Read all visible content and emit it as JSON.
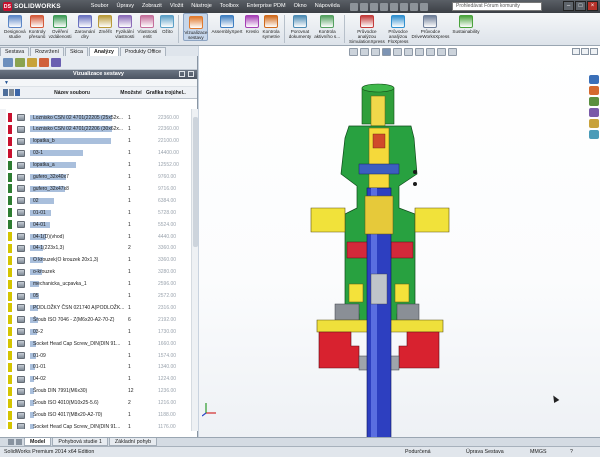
{
  "app": {
    "brand": "SOLIDWORKS",
    "menu": [
      "Soubor",
      "Úpravy",
      "Zobrazit",
      "Vložit",
      "Nástroje",
      "Toolbox",
      "Enterprise PDM",
      "Okno",
      "Nápověda"
    ],
    "search_placeholder": "Prohledávat Fórum komunity"
  },
  "commandmanager": {
    "buttons": [
      {
        "label": "Designová\nstudie",
        "icon": "design-study-icon",
        "color": "#5b86c6"
      },
      {
        "label": "Kontroly\npřesunů",
        "icon": "interference-check-icon",
        "color": "#d45a3a"
      },
      {
        "label": "Ověření\nvzdálenosti",
        "icon": "clearance-verification-icon",
        "color": "#3d9a57"
      },
      {
        "label": "Zarovnání\ndíry",
        "icon": "hole-alignment-icon",
        "color": "#6a72c0"
      },
      {
        "label": "Změřit",
        "icon": "measure-icon",
        "color": "#b99a3a"
      },
      {
        "label": "Fyzikální\nvlastnosti",
        "icon": "mass-properties-icon",
        "color": "#8b6bb8"
      },
      {
        "label": "Vlastnosti\nentit",
        "icon": "section-properties-icon",
        "color": "#c46f9b"
      },
      {
        "label": "Ožito",
        "icon": "check-icon",
        "color": "#5b9fc6"
      },
      {
        "label": "Vizualizace\nsestavy",
        "icon": "assembly-visualization-icon",
        "color": "#e07a2e",
        "active": true
      },
      {
        "label": "AssemblyXpert",
        "icon": "assemblyxpert-icon",
        "color": "#3f7fc1"
      },
      {
        "label": "Kreslo",
        "icon": "sketch-check-icon",
        "color": "#a53fb5"
      },
      {
        "label": "Kontrola\nsymetrie",
        "icon": "symmetry-check-icon",
        "color": "#d06a1c"
      },
      {
        "label": "Porovnat\ndokumenty",
        "icon": "compare-documents-icon",
        "color": "#4b8ab3"
      },
      {
        "label": "Kontrola\naktivního s...",
        "icon": "active-doc-check-icon",
        "color": "#54a060"
      },
      {
        "label": "Průvodce\nanalýzou\nSimulationXpress",
        "icon": "simulationxpress-icon",
        "color": "#c33b3b"
      },
      {
        "label": "Průvodce\nanalýzou\nFloXpress",
        "icon": "floxpress-icon",
        "color": "#2f8fcf"
      },
      {
        "label": "Průvodce\nDriveWorksXpress",
        "icon": "driveworksxpress-icon",
        "color": "#6d7d97"
      },
      {
        "label": "Sustainability",
        "icon": "sustainability-icon",
        "color": "#4aa33c"
      }
    ],
    "tabs": [
      {
        "label": "Sestava"
      },
      {
        "label": "Rozvržení"
      },
      {
        "label": "Skica"
      },
      {
        "label": "Analýzy",
        "active": true
      },
      {
        "label": "Produkty Office"
      }
    ]
  },
  "panel": {
    "title": "Vizualizace sestavy",
    "filter_label": "▼",
    "columns": {
      "name": "Název souboru",
      "qty": "Množství",
      "graph": "Grafika trojúhel..."
    },
    "rows": [
      {
        "name": "Loznisko CSN 02 4701(22205 (25x52x...",
        "qty": "1",
        "value": "22360.00",
        "strip": "#c8102e",
        "bar": 0.98
      },
      {
        "name": "Loznisko CSN 02 4701(22206 (30x62x...",
        "qty": "1",
        "value": "22360.00",
        "strip": "#c8102e",
        "bar": 0.98
      },
      {
        "name": "lopatka_b",
        "qty": "1",
        "value": "22100.00",
        "strip": "#c8102e",
        "bar": 0.97
      },
      {
        "name": "03-1",
        "qty": "1",
        "value": "14400.00",
        "strip": "#c8102e",
        "bar": 0.63
      },
      {
        "name": "lopatka_a",
        "qty": "1",
        "value": "12552.00",
        "strip": "#2e7d32",
        "bar": 0.55
      },
      {
        "name": "gufero_32x40x7",
        "qty": "1",
        "value": "9760.00",
        "strip": "#2e7d32",
        "bar": 0.43
      },
      {
        "name": "gufero_32x47x8",
        "qty": "1",
        "value": "9716.00",
        "strip": "#2e7d32",
        "bar": 0.42
      },
      {
        "name": "02",
        "qty": "1",
        "value": "6384.00",
        "strip": "#2e7d32",
        "bar": 0.28
      },
      {
        "name": "01-01",
        "qty": "1",
        "value": "5728.00",
        "strip": "#2e7d32",
        "bar": 0.25
      },
      {
        "name": "04-01",
        "qty": "1",
        "value": "5524.00",
        "strip": "#2e7d32",
        "bar": 0.24
      },
      {
        "name": "04-1(D)(vhod)",
        "qty": "1",
        "value": "4440.00",
        "strip": "#d4c400",
        "bar": 0.19
      },
      {
        "name": "04-1(223x1,3)",
        "qty": "2",
        "value": "3360.00",
        "strip": "#d4c400",
        "bar": 0.15
      },
      {
        "name": "O krouzek(O krouzek 20x1,3)",
        "qty": "1",
        "value": "3360.00",
        "strip": "#d4c400",
        "bar": 0.15
      },
      {
        "name": "o-krouzek",
        "qty": "1",
        "value": "3280.00",
        "strip": "#d4c400",
        "bar": 0.14
      },
      {
        "name": "mechanicka_ucpavka_1",
        "qty": "1",
        "value": "2596.00",
        "strip": "#d4c400",
        "bar": 0.11
      },
      {
        "name": "05",
        "qty": "1",
        "value": "2572.00",
        "strip": "#d4c400",
        "bar": 0.11
      },
      {
        "name": "PODLOŽKY ČSN 021740 A(PODLOŽK...",
        "qty": "1",
        "value": "2316.00",
        "strip": "#d4c400",
        "bar": 0.1
      },
      {
        "name": "Šroub ISO 7046 - Z(M6x20-A2-70-Z)",
        "qty": "6",
        "value": "2192.00",
        "strip": "#d4c400",
        "bar": 0.09
      },
      {
        "name": "03-2",
        "qty": "1",
        "value": "1730.00",
        "strip": "#d4c400",
        "bar": 0.08
      },
      {
        "name": "Socket Head Cap Screw_DIN(DIN 91...",
        "qty": "1",
        "value": "1660.00",
        "strip": "#d4c400",
        "bar": 0.07
      },
      {
        "name": "01-09",
        "qty": "1",
        "value": "1574.00",
        "strip": "#d4c400",
        "bar": 0.07
      },
      {
        "name": "01-01",
        "qty": "1",
        "value": "1340.00",
        "strip": "#d4c400",
        "bar": 0.06
      },
      {
        "name": "04-02",
        "qty": "1",
        "value": "1224.00",
        "strip": "#d4c400",
        "bar": 0.05
      },
      {
        "name": "Šroub DIN 7991(M6x30)",
        "qty": "12",
        "value": "1236.00",
        "strip": "#d4c400",
        "bar": 0.05
      },
      {
        "name": "Šroub ISO 4010(M10x25-5.6)",
        "qty": "2",
        "value": "1216.00",
        "strip": "#d4c400",
        "bar": 0.05
      },
      {
        "name": "Šroub ISO 4017(M8x20-A2-70)",
        "qty": "1",
        "value": "1188.00",
        "strip": "#d4c400",
        "bar": 0.05
      },
      {
        "name": "Socket Head Cap Screw_DIN(DIN 91...",
        "qty": "1",
        "value": "1176.00",
        "strip": "#d4c400",
        "bar": 0.05
      }
    ]
  },
  "bottom_tabs": [
    {
      "label": "Model",
      "active": true
    },
    {
      "label": "Pohybová studie 1"
    },
    {
      "label": "Základní pohyb"
    }
  ],
  "status": {
    "edition": "SolidWorks Premium 2014 x64 Edition",
    "state": "Podurčená",
    "mode": "Úprava Sestava",
    "units": "MMGS"
  }
}
